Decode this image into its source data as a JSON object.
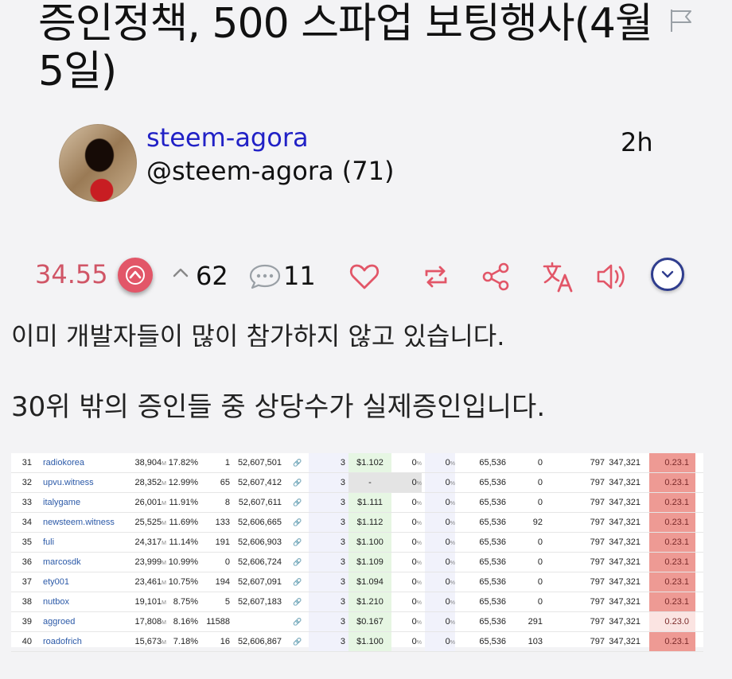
{
  "post": {
    "title": "증인정책, 500 스파업 보팅행사(4월 5일)",
    "author_name": "steem-agora",
    "author_handle": "@steem-agora (71)",
    "time_ago": "2h"
  },
  "actions": {
    "payout": "34.55",
    "votes_count": "62",
    "comments_count": "11"
  },
  "body": {
    "clipped_line": "이미 개발자들이 많이 참가하지 않고 있습니다.",
    "paragraph": "30위 밖의 증인들 중 상당수가 실제증인입니다."
  },
  "colors": {
    "accent": "#e25668",
    "author_link": "#2121c6",
    "expand_border": "#2f3d8e",
    "price_cell": "#e6f6e3",
    "version_cell": "#ee9a94"
  },
  "icons": [
    "flag-icon",
    "upvote-icon",
    "caret-up-icon",
    "comment-icon",
    "heart-icon",
    "resteem-icon",
    "share-icon",
    "translate-icon",
    "speaker-icon",
    "chevron-down-icon",
    "link-icon"
  ],
  "witness_table": {
    "rows": [
      {
        "rank": "31",
        "name": "radiokorea",
        "votes": "38,904",
        "unit": "M",
        "pct": "17.82%",
        "missed": "1",
        "block": "52,607,501",
        "three": "3",
        "price": "$1.102",
        "z1": "0",
        "z2": "0",
        "n1": "65,536",
        "n2": "0",
        "n3": "797",
        "n4": "347,321",
        "ver": "0.23.1",
        "price_gray": false,
        "block_faded": false,
        "ver_light": false
      },
      {
        "rank": "32",
        "name": "upvu.witness",
        "votes": "28,352",
        "unit": "M",
        "pct": "12.99%",
        "missed": "65",
        "block": "52,607,412",
        "three": "3",
        "price": "-",
        "z1": "0",
        "z2": "0",
        "n1": "65,536",
        "n2": "0",
        "n3": "797",
        "n4": "347,321",
        "ver": "0.23.1",
        "price_gray": true,
        "block_faded": false,
        "ver_light": false
      },
      {
        "rank": "33",
        "name": "italygame",
        "votes": "26,001",
        "unit": "M",
        "pct": "11.91%",
        "missed": "8",
        "block": "52,607,611",
        "three": "3",
        "price": "$1.111",
        "z1": "0",
        "z2": "0",
        "n1": "65,536",
        "n2": "0",
        "n3": "797",
        "n4": "347,321",
        "ver": "0.23.1",
        "price_gray": false,
        "block_faded": false,
        "ver_light": false
      },
      {
        "rank": "34",
        "name": "newsteem.witness",
        "votes": "25,525",
        "unit": "M",
        "pct": "11.69%",
        "missed": "133",
        "block": "52,606,665",
        "three": "3",
        "price": "$1.112",
        "z1": "0",
        "z2": "0",
        "n1": "65,536",
        "n2": "92",
        "n3": "797",
        "n4": "347,321",
        "ver": "0.23.1",
        "price_gray": false,
        "block_faded": false,
        "ver_light": false
      },
      {
        "rank": "35",
        "name": "fuli",
        "votes": "24,317",
        "unit": "M",
        "pct": "11.14%",
        "missed": "191",
        "block": "52,606,903",
        "three": "3",
        "price": "$1.100",
        "z1": "0",
        "z2": "0",
        "n1": "65,536",
        "n2": "0",
        "n3": "797",
        "n4": "347,321",
        "ver": "0.23.1",
        "price_gray": false,
        "block_faded": false,
        "ver_light": false
      },
      {
        "rank": "36",
        "name": "marcosdk",
        "votes": "23,999",
        "unit": "M",
        "pct": "10.99%",
        "missed": "0",
        "block": "52,606,724",
        "three": "3",
        "price": "$1.109",
        "z1": "0",
        "z2": "0",
        "n1": "65,536",
        "n2": "0",
        "n3": "797",
        "n4": "347,321",
        "ver": "0.23.1",
        "price_gray": false,
        "block_faded": false,
        "ver_light": false
      },
      {
        "rank": "37",
        "name": "ety001",
        "votes": "23,461",
        "unit": "M",
        "pct": "10.75%",
        "missed": "194",
        "block": "52,607,091",
        "three": "3",
        "price": "$1.094",
        "z1": "0",
        "z2": "0",
        "n1": "65,536",
        "n2": "0",
        "n3": "797",
        "n4": "347,321",
        "ver": "0.23.1",
        "price_gray": false,
        "block_faded": false,
        "ver_light": false
      },
      {
        "rank": "38",
        "name": "nutbox",
        "votes": "19,101",
        "unit": "M",
        "pct": "8.75%",
        "missed": "5",
        "block": "52,607,183",
        "three": "3",
        "price": "$1.210",
        "z1": "0",
        "z2": "0",
        "n1": "65,536",
        "n2": "0",
        "n3": "797",
        "n4": "347,321",
        "ver": "0.23.1",
        "price_gray": false,
        "block_faded": false,
        "ver_light": false
      },
      {
        "rank": "39",
        "name": "aggroed",
        "votes": "17,808",
        "unit": "M",
        "pct": "8.16%",
        "missed": "11588",
        "block": "",
        "three": "3",
        "price": "$0.167",
        "z1": "0",
        "z2": "0",
        "n1": "65,536",
        "n2": "291",
        "n3": "797",
        "n4": "347,321",
        "ver": "0.23.0",
        "price_gray": false,
        "block_faded": true,
        "ver_light": true
      },
      {
        "rank": "40",
        "name": "roadofrich",
        "votes": "15,673",
        "unit": "M",
        "pct": "7.18%",
        "missed": "16",
        "block": "52,606,867",
        "three": "3",
        "price": "$1.100",
        "z1": "0",
        "z2": "0",
        "n1": "65,536",
        "n2": "103",
        "n3": "797",
        "n4": "347,321",
        "ver": "0.23.1",
        "price_gray": false,
        "block_faded": false,
        "ver_light": false
      }
    ],
    "pct_unit": "%"
  }
}
